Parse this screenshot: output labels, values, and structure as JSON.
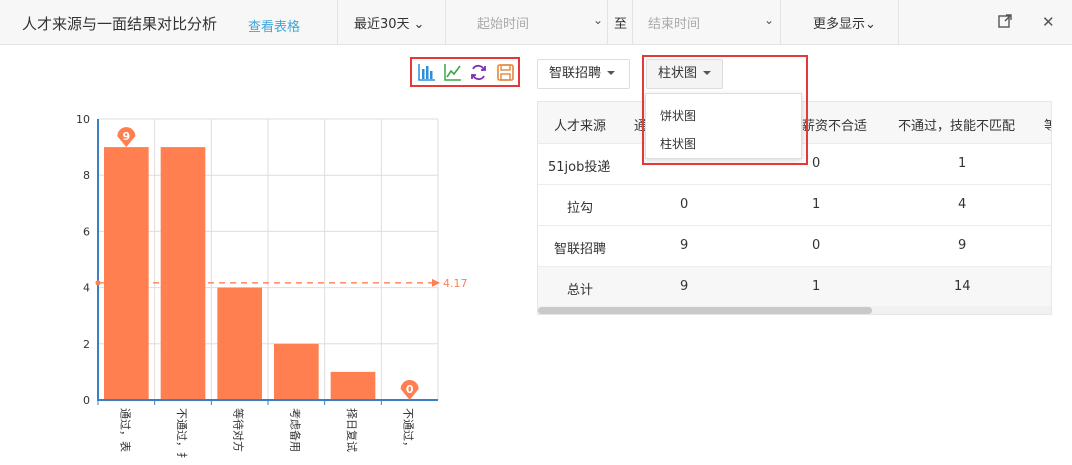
{
  "header": {
    "title": "人才来源与一面结果对比分析",
    "table_link": "查看表格",
    "period": "最近30天",
    "start_placeholder": "起始时间",
    "to": "至",
    "end_placeholder": "结束时间",
    "more": "更多显示"
  },
  "toolbar_icons": [
    "bar-chart-icon",
    "line-chart-icon",
    "refresh-icon",
    "save-icon"
  ],
  "controls": {
    "source_select": "智联招聘",
    "chart_type_select": "柱状图",
    "chart_type_options": [
      "饼状图",
      "柱状图"
    ]
  },
  "table": {
    "headers": [
      "人才来源",
      "通",
      "薪资不合适",
      "不通过，技能不匹配",
      "等"
    ],
    "rows": [
      [
        "51job投递",
        "",
        "0",
        "1"
      ],
      [
        "拉勾",
        "0",
        "1",
        "4"
      ],
      [
        "智联招聘",
        "9",
        "0",
        "9"
      ],
      [
        "总计",
        "9",
        "1",
        "14"
      ]
    ]
  },
  "chart_data": {
    "type": "bar",
    "categories": [
      "通过，表",
      "不通过，扌",
      "等待对方",
      "考虑备用",
      "择日复试",
      "不通过，"
    ],
    "values": [
      9,
      9,
      4,
      2,
      1,
      0
    ],
    "ylim": [
      0,
      10
    ],
    "yticks": [
      "0",
      "2",
      "4",
      "6",
      "8",
      "10"
    ],
    "max_marker": "9",
    "min_marker": "0",
    "mean_line": 4.17,
    "mean_label": "4.17",
    "color": "#ff7f50",
    "grid": true
  }
}
